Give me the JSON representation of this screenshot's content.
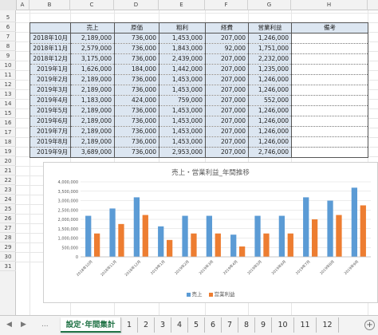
{
  "columns": [
    "A",
    "B",
    "C",
    "D",
    "E",
    "F",
    "G",
    "H"
  ],
  "rows": [
    5,
    6,
    7,
    8,
    9,
    10,
    11,
    12,
    13,
    14,
    15,
    16,
    17,
    18,
    19,
    20,
    21,
    22,
    23,
    24,
    25,
    26,
    27,
    28,
    29,
    30,
    31
  ],
  "table": {
    "headers": [
      "",
      "売上",
      "原価",
      "粗利",
      "経費",
      "営業利益",
      "備考"
    ],
    "rows": [
      [
        "2018年10月",
        "2,189,000",
        "736,000",
        "1,453,000",
        "207,000",
        "1,246,000",
        ""
      ],
      [
        "2018年11月",
        "2,579,000",
        "736,000",
        "1,843,000",
        "92,000",
        "1,751,000",
        ""
      ],
      [
        "2018年12月",
        "3,175,000",
        "736,000",
        "2,439,000",
        "207,000",
        "2,232,000",
        ""
      ],
      [
        "2019年1月",
        "1,626,000",
        "184,000",
        "1,442,000",
        "207,000",
        "1,235,000",
        ""
      ],
      [
        "2019年2月",
        "2,189,000",
        "736,000",
        "1,453,000",
        "207,000",
        "1,246,000",
        ""
      ],
      [
        "2019年3月",
        "2,189,000",
        "736,000",
        "1,453,000",
        "207,000",
        "1,246,000",
        ""
      ],
      [
        "2019年4月",
        "1,183,000",
        "424,000",
        "759,000",
        "207,000",
        "552,000",
        ""
      ],
      [
        "2019年5月",
        "2,189,000",
        "736,000",
        "1,453,000",
        "207,000",
        "1,246,000",
        ""
      ],
      [
        "2019年6月",
        "2,189,000",
        "736,000",
        "1,453,000",
        "207,000",
        "1,246,000",
        ""
      ],
      [
        "2019年7月",
        "2,189,000",
        "736,000",
        "1,453,000",
        "207,000",
        "1,246,000",
        ""
      ],
      [
        "2019年8月",
        "2,189,000",
        "736,000",
        "1,453,000",
        "207,000",
        "1,246,000",
        ""
      ],
      [
        "2019年9月",
        "3,689,000",
        "736,000",
        "2,953,000",
        "207,000",
        "2,746,000",
        ""
      ]
    ]
  },
  "chart_data": {
    "type": "bar",
    "title": "売上・営業利益_年間推移",
    "categories": [
      "2018年10月",
      "2018年11月",
      "2018年12月",
      "2019年1月",
      "2019年2月",
      "2019年3月",
      "2019年4月",
      "2019年5月",
      "2019年6月",
      "2019年7月",
      "2019年8月",
      "2019年9月"
    ],
    "series": [
      {
        "name": "売上",
        "color": "#5b9bd5",
        "values": [
          2189000,
          2579000,
          3175000,
          1626000,
          2189000,
          2189000,
          1183000,
          2189000,
          2189000,
          3175000,
          3000000,
          3689000
        ]
      },
      {
        "name": "営業利益",
        "color": "#ed7d31",
        "values": [
          1246000,
          1751000,
          2232000,
          900000,
          1246000,
          1246000,
          552000,
          1246000,
          1246000,
          2000000,
          2232000,
          2746000
        ]
      }
    ],
    "ylim": [
      0,
      4000000
    ],
    "yticks": [
      "0",
      "500,000",
      "1,000,000",
      "1,500,000",
      "2,000,000",
      "2,500,000",
      "3,000,000",
      "3,500,000",
      "4,000,000"
    ],
    "grid": true,
    "legend": "bottom"
  },
  "tabs": {
    "active": "設定･年間集計",
    "sheets": [
      "1",
      "2",
      "3",
      "4",
      "5",
      "6",
      "7",
      "8",
      "9",
      "10",
      "11",
      "12"
    ],
    "add_symbol": "+",
    "prev_arrow": "◀",
    "next_arrow": "▶",
    "more": "..."
  }
}
